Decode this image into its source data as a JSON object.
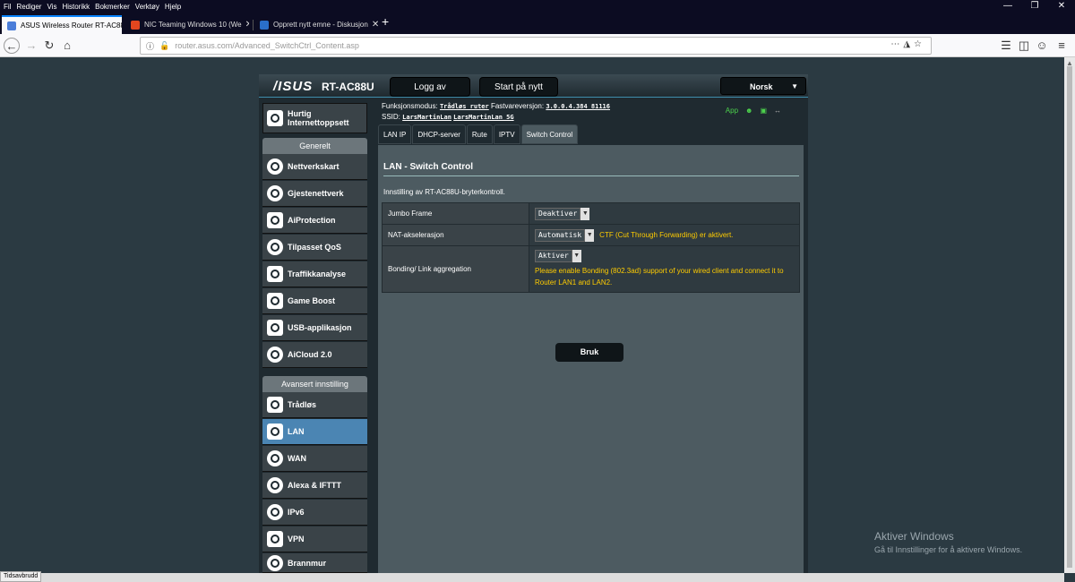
{
  "browser": {
    "menu": [
      "Fil",
      "Rediger",
      "Vis",
      "Historikk",
      "Bokmerker",
      "Verktøy",
      "Hjelp"
    ],
    "tabs": [
      {
        "label": "ASUS Wireless Router RT-AC88U"
      },
      {
        "label": "NIC Teaming Windows 10 (We"
      },
      {
        "label": "Opprett nytt emne - Diskusjon"
      }
    ],
    "new_tab": "+",
    "url_host": "router.asus.com",
    "url_path": "/Advanced_SwitchCtrl_Content.asp",
    "status": "Tidsavbrudd"
  },
  "router": {
    "logo": "/ISUS",
    "model": "RT-AC88U",
    "logout": "Logg av",
    "reboot": "Start på nytt",
    "language": "Norsk",
    "mode_label": "Funksjonsmodus:",
    "mode_value": "Trådløs ruter",
    "fw_label": "Fastvareversjon:",
    "fw_value": "3.0.0.4.384_81116",
    "ssid_label": "SSID:",
    "ssid_1": "LarsMartinLan",
    "ssid_2": "LarsMartinLan_5G",
    "app_label": "App",
    "quick_setup_1": "Hurtig",
    "quick_setup_2": "Internettoppsett",
    "general_header": "Generelt",
    "general_items": [
      "Nettverkskart",
      "Gjestenettverk",
      "AiProtection",
      "Tilpasset QoS",
      "Traffikkanalyse",
      "Game Boost",
      "USB-applikasjon",
      "AiCloud 2.0"
    ],
    "advanced_header": "Avansert innstilling",
    "advanced_items": [
      "Trådløs",
      "LAN",
      "WAN",
      "Alexa & IFTTT",
      "IPv6",
      "VPN",
      "Brannmur"
    ],
    "tabs": [
      "LAN IP",
      "DHCP-server",
      "Rute",
      "IPTV",
      "Switch Control"
    ],
    "page_title": "LAN - Switch Control",
    "page_desc": "Innstilling av RT-AC88U-bryterkontroll.",
    "rows": [
      {
        "label": "Jumbo Frame",
        "value": "Deaktiver",
        "note": ""
      },
      {
        "label": "NAT-akselerasjon",
        "value": "Automatisk",
        "note": "CTF (Cut Through Forwarding) er aktivert."
      },
      {
        "label": "Bonding/ Link aggregation",
        "value": "Aktiver",
        "note": "Please enable Bonding (802.3ad) support of your wired client and connect it to Router LAN1 and LAN2."
      }
    ],
    "apply": "Bruk"
  },
  "watermark": {
    "line1": "Aktiver Windows",
    "line2": "Gå til Innstillinger for å aktivere Windows."
  }
}
